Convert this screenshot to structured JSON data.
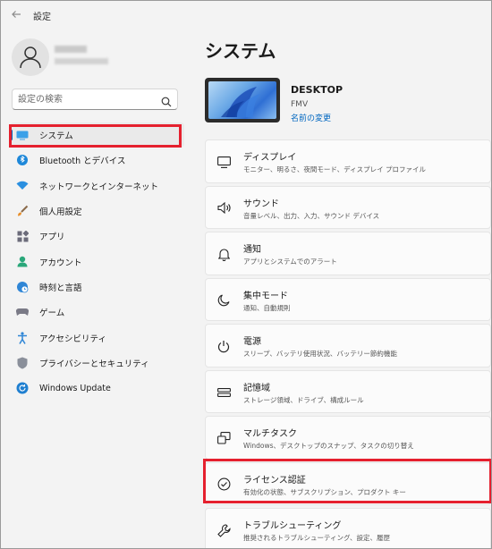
{
  "window": {
    "title": "設定",
    "back_icon": "back-arrow-icon"
  },
  "user": {
    "name": "",
    "email": ""
  },
  "search": {
    "placeholder": "設定の検索",
    "icon": "search-icon"
  },
  "sidebar": {
    "items": [
      {
        "label": "システム",
        "icon": "system-monitor-icon",
        "active": true
      },
      {
        "label": "Bluetooth とデバイス",
        "icon": "bluetooth-icon"
      },
      {
        "label": "ネットワークとインターネット",
        "icon": "wifi-icon"
      },
      {
        "label": "個人用設定",
        "icon": "brush-icon"
      },
      {
        "label": "アプリ",
        "icon": "apps-icon"
      },
      {
        "label": "アカウント",
        "icon": "account-icon"
      },
      {
        "label": "時刻と言語",
        "icon": "globe-clock-icon"
      },
      {
        "label": "ゲーム",
        "icon": "gamepad-icon"
      },
      {
        "label": "アクセシビリティ",
        "icon": "accessibility-icon"
      },
      {
        "label": "プライバシーとセキュリティ",
        "icon": "shield-icon"
      },
      {
        "label": "Windows Update",
        "icon": "update-icon"
      }
    ]
  },
  "main": {
    "heading": "システム",
    "device": {
      "name": "DESKTOP",
      "model": "FMV",
      "rename_label": "名前の変更"
    },
    "cards": [
      {
        "title": "ディスプレイ",
        "subtitle": "モニター、明るさ、夜間モード、ディスプレイ プロファイル",
        "icon": "display-icon"
      },
      {
        "title": "サウンド",
        "subtitle": "音量レベル、出力、入力、サウンド デバイス",
        "icon": "speaker-icon"
      },
      {
        "title": "通知",
        "subtitle": "アプリとシステムでのアラート",
        "icon": "bell-icon"
      },
      {
        "title": "集中モード",
        "subtitle": "通知、自動規則",
        "icon": "moon-icon"
      },
      {
        "title": "電源",
        "subtitle": "スリープ、バッテリ使用状況、バッテリー節約機能",
        "icon": "power-icon"
      },
      {
        "title": "記憶域",
        "subtitle": "ストレージ領域、ドライブ、構成ルール",
        "icon": "storage-icon"
      },
      {
        "title": "マルチタスク",
        "subtitle": "Windows、デスクトップのスナップ、タスクの切り替え",
        "icon": "multitask-icon"
      },
      {
        "title": "ライセンス認証",
        "subtitle": "有効化の状態、サブスクリプション、プロダクト キー",
        "icon": "check-circle-icon"
      },
      {
        "title": "トラブルシューティング",
        "subtitle": "推奨されるトラブルシューティング、設定、履歴",
        "icon": "wrench-icon"
      }
    ]
  },
  "colors": {
    "accent": "#0067c0",
    "highlight": "#e5202e"
  }
}
